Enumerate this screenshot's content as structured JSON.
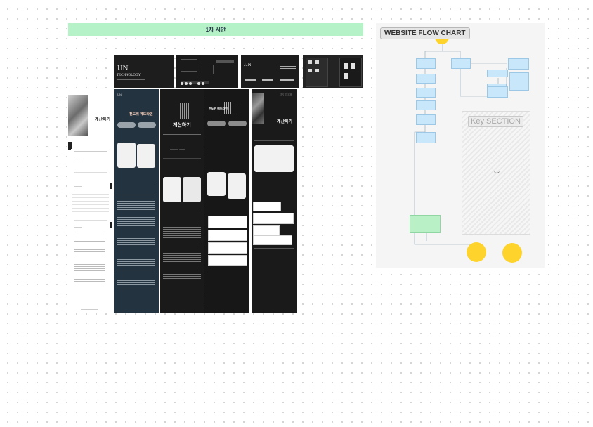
{
  "canvas": {
    "section_banner": "1차 시안"
  },
  "top_row": {
    "thumb1_brand": "JJN",
    "thumb1_sub": "TECHNOLOGY",
    "thumb3_brand": "JJN"
  },
  "mockups": {
    "light_title": "계산하기",
    "navy_title": "전도위 헤드라인",
    "dark1_title": "계산하기",
    "dark2_title": "전도위 헤드라인",
    "dark3_title": "계산하기",
    "dark3_brand": "JJN TECH"
  },
  "flowchart": {
    "title": "WEBSITE FLOW CHART",
    "key_section_title": "Key SECTION"
  },
  "colors": {
    "banner": "#b6f2c8",
    "flow_box": "#c8e7fb",
    "flow_circle": "#fdd32c",
    "flow_green": "#b9f0c6"
  }
}
